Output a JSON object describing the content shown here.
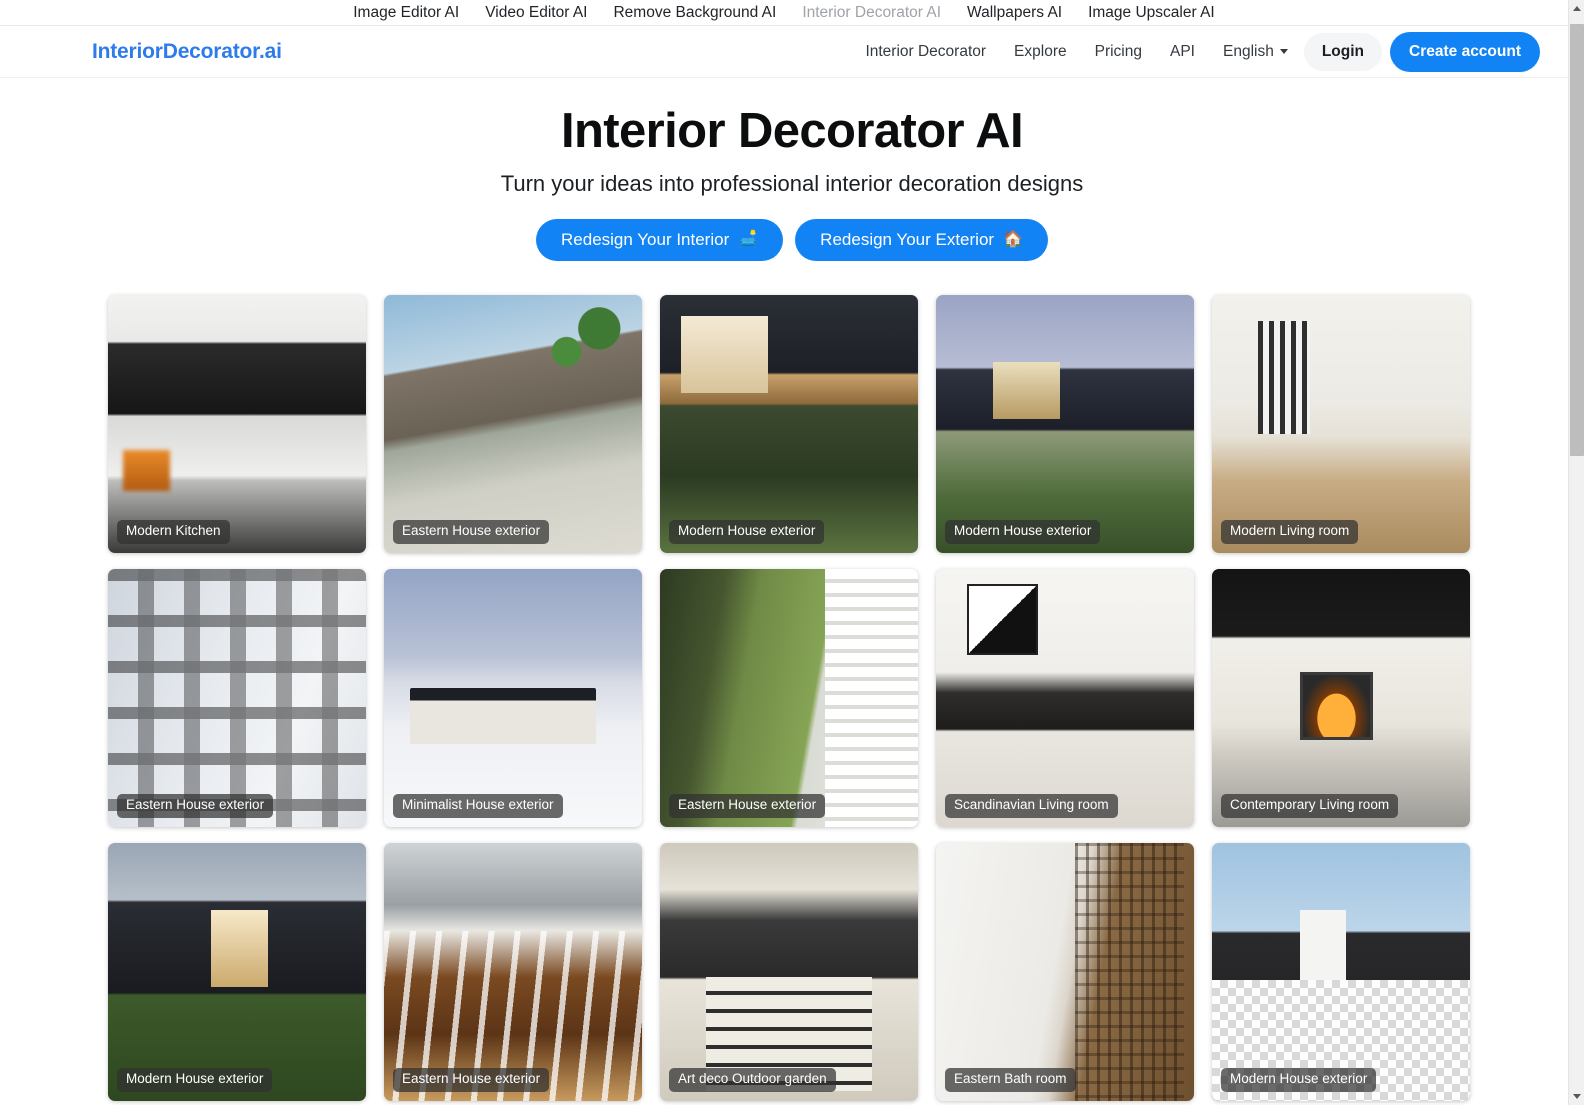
{
  "topbar": {
    "links": [
      {
        "label": "Image Editor AI",
        "muted": false
      },
      {
        "label": "Video Editor AI",
        "muted": false
      },
      {
        "label": "Remove Background AI",
        "muted": false
      },
      {
        "label": "Interior Decorator AI",
        "muted": true
      },
      {
        "label": "Wallpapers AI",
        "muted": false
      },
      {
        "label": "Image Upscaler AI",
        "muted": false
      }
    ]
  },
  "navbar": {
    "brand": "InteriorDecorator.ai",
    "links": [
      {
        "label": "Interior Decorator"
      },
      {
        "label": "Explore"
      },
      {
        "label": "Pricing"
      },
      {
        "label": "API"
      }
    ],
    "language": "English",
    "login_label": "Login",
    "create_account_label": "Create account"
  },
  "hero": {
    "title": "Interior Decorator AI",
    "subtitle": "Turn your ideas into professional interior decoration designs",
    "primary_button": {
      "label": "Redesign Your Interior",
      "emoji": "🛋️"
    },
    "secondary_button": {
      "label": "Redesign Your Exterior",
      "emoji": "🏠"
    }
  },
  "gallery": {
    "items": [
      {
        "caption": "Modern Kitchen",
        "art": "a-kitchen",
        "partial": false
      },
      {
        "caption": "Eastern House exterior",
        "art": "a-east1",
        "partial": false
      },
      {
        "caption": "Modern House exterior",
        "art": "a-mod1",
        "partial": false
      },
      {
        "caption": "Modern House exterior",
        "art": "a-mod2",
        "partial": false
      },
      {
        "caption": "Modern Living room",
        "art": "a-living1",
        "partial": false
      },
      {
        "caption": "Eastern House exterior",
        "art": "a-east2",
        "partial": false
      },
      {
        "caption": "Minimalist House exterior",
        "art": "a-min",
        "partial": false
      },
      {
        "caption": "Eastern House exterior",
        "art": "a-east3",
        "partial": false
      },
      {
        "caption": "Scandinavian Living room",
        "art": "a-scand",
        "partial": false
      },
      {
        "caption": "Contemporary Living room",
        "art": "a-contemp",
        "partial": false
      },
      {
        "caption": "Modern House exterior",
        "art": "a-mod3",
        "partial": false
      },
      {
        "caption": "Eastern House exterior",
        "art": "a-east4",
        "partial": false
      },
      {
        "caption": "Art deco Outdoor garden",
        "art": "a-artdeco",
        "partial": false
      },
      {
        "caption": "Eastern Bath room",
        "art": "a-bath",
        "partial": false
      },
      {
        "caption": "Modern House exterior",
        "art": "a-mod4",
        "partial": true
      }
    ]
  },
  "colors": {
    "brand_blue": "#2e7ceb",
    "button_blue": "#1283f5",
    "login_bg": "#f4f5f7",
    "caption_bg": "rgba(48,48,48,0.72)",
    "muted_link": "#9fa3a8"
  }
}
